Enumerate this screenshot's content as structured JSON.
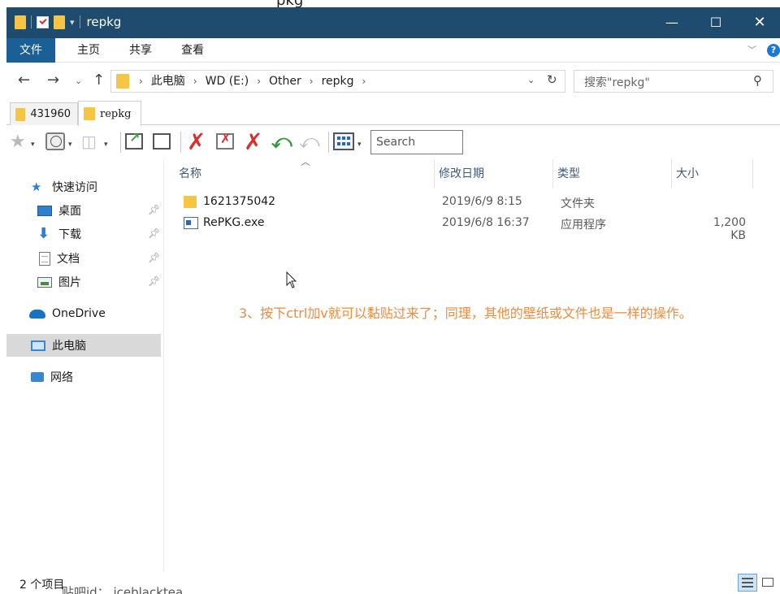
{
  "window": {
    "title": "repkg",
    "minimize_glyph": "—",
    "maximize_glyph": "☐",
    "close_glyph": "✕"
  },
  "ribbon": {
    "tabs": [
      {
        "label": "文件"
      },
      {
        "label": "主页"
      },
      {
        "label": "共享"
      },
      {
        "label": "查看"
      }
    ]
  },
  "address": {
    "crumbs": [
      "此电脑",
      "WD (E:)",
      "Other",
      "repkg"
    ],
    "search_placeholder": "搜索\"repkg\""
  },
  "folder_tabs": [
    {
      "label": "431960"
    },
    {
      "label": "repkg"
    }
  ],
  "toolbar": {
    "search_placeholder": "Search"
  },
  "sidebar": {
    "items": [
      {
        "label": "快速访问",
        "icon": "star-icon"
      },
      {
        "label": "桌面",
        "icon": "desktop-icon",
        "pinned": true
      },
      {
        "label": "下载",
        "icon": "download-icon",
        "pinned": true
      },
      {
        "label": "文档",
        "icon": "documents-icon",
        "pinned": true
      },
      {
        "label": "图片",
        "icon": "pictures-icon",
        "pinned": true
      },
      {
        "label": "OneDrive",
        "icon": "onedrive-icon"
      },
      {
        "label": "此电脑",
        "icon": "this-pc-icon",
        "selected": true
      },
      {
        "label": "网络",
        "icon": "network-icon"
      }
    ]
  },
  "file_list": {
    "columns": [
      "名称",
      "修改日期",
      "类型",
      "大小"
    ],
    "rows": [
      {
        "name": "1621375042",
        "date": "2019/6/9 8:15",
        "type": "文件夹",
        "size": "",
        "icon": "folder-icon"
      },
      {
        "name": "RePKG.exe",
        "date": "2019/6/8 16:37",
        "type": "应用程序",
        "size": "1,200 KB",
        "icon": "exe-icon"
      }
    ]
  },
  "annotation": "3、按下ctrl加v就可以黏贴过来了；同理，其他的壁纸或文件也是一样的操作。",
  "status": {
    "item_count": "2 个项目",
    "watermark": "贴吧id：    iceblacktea"
  },
  "colors": {
    "titlebar": "#1e4b6e",
    "file_tab": "#1a5f96",
    "annotation": "#f08a3c",
    "selected_nav": "#d9d9d9"
  }
}
